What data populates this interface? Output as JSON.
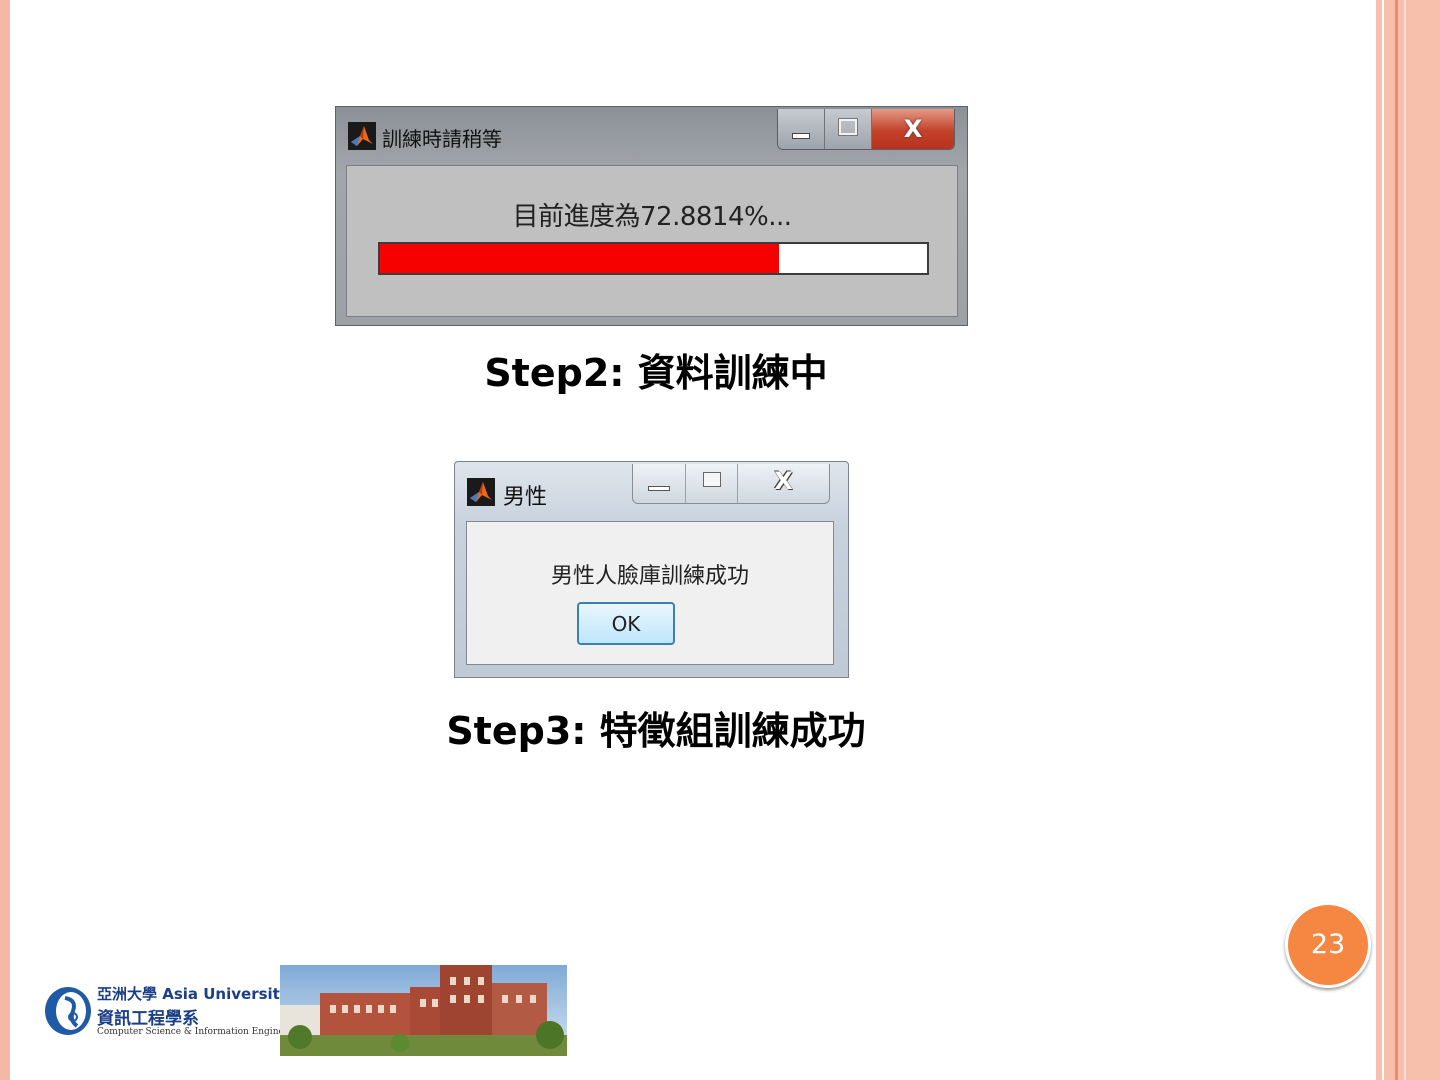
{
  "slide": {
    "page_number": "23"
  },
  "progress_window": {
    "title": "訓練時請稍等",
    "app_icon": "matlab-icon",
    "buttons": {
      "minimize_icon": "minimize-icon",
      "maximize_icon": "maximize-icon",
      "close_label": "X"
    },
    "message": "目前進度為72.8814%...",
    "progress_percent": 72.8814,
    "colors": {
      "fill": "#f60000",
      "track": "#ffffff"
    }
  },
  "caption1": "Step2: 資料訓練中",
  "message_window": {
    "title": "男性",
    "app_icon": "matlab-icon",
    "buttons": {
      "minimize_icon": "minimize-icon",
      "maximize_icon": "maximize-icon",
      "close_label": "X"
    },
    "message": "男性人臉庫訓練成功",
    "ok_label": "OK"
  },
  "caption2": "Step3: 特徵組訓練成功",
  "footer": {
    "logo_line1": "亞洲大學 Asia University",
    "logo_line2": "資訊工程學系",
    "logo_line3": "Computer Science & Information Engineering",
    "photo": "campus-photo"
  },
  "colors": {
    "accent": "#f58743",
    "stripe": "#f4b9a4"
  }
}
